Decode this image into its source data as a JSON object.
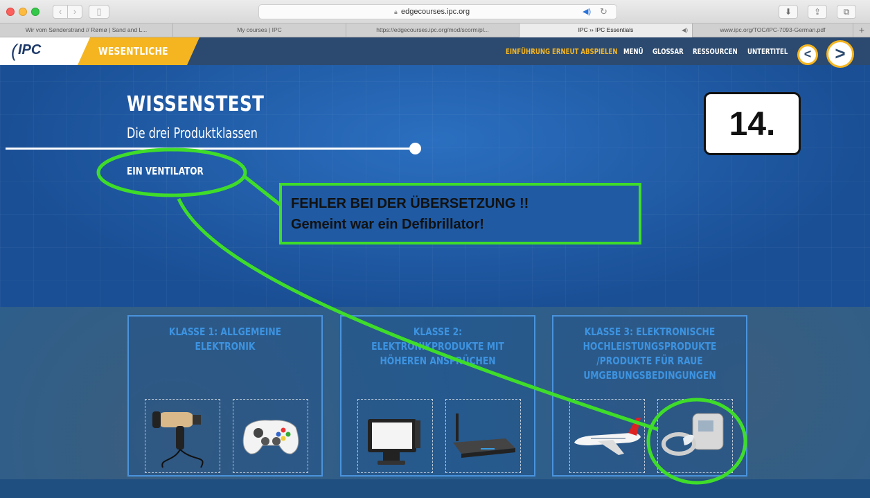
{
  "browser": {
    "url": "edgecourses.ipc.org",
    "tabs": [
      {
        "label": "Wir vom Sønderstrand // Rømø | Sand and L..."
      },
      {
        "label": "My courses | IPC"
      },
      {
        "label": "https://edgecourses.ipc.org/mod/scorm/pl..."
      },
      {
        "label": "IPC ›› IPC Essentials"
      },
      {
        "label": "www.ipc.org/TOC/IPC-7093-German.pdf"
      }
    ],
    "new_tab_label": "+"
  },
  "course": {
    "logo": "IPC",
    "module": "WESENTLICHE",
    "menu": {
      "replay": "EINFÜHRUNG ERNEUT ABSPIELEN",
      "menu": "MENÜ",
      "glossary": "GLOSSAR",
      "resources": "RESSOURCEN",
      "subtitles": "UNTERTITEL"
    },
    "nav": {
      "prev": "<",
      "next": ">"
    },
    "title": "WISSENSTEST",
    "subtitle": "Die drei Produktklassen",
    "answer": "EIN VENTILATOR",
    "cards": [
      {
        "title_lines": [
          "KLASSE 1: ALLGEMEINE",
          "ELEKTRONIK"
        ],
        "products": [
          "hair-dryer",
          "game-controller"
        ]
      },
      {
        "title_lines": [
          "KLASSE 2:",
          "ELEKTRONIKPRODUKTE MIT",
          "HÖHEREN ANSPRÜCHEN"
        ],
        "products": [
          "pos-terminal",
          "wifi-router"
        ]
      },
      {
        "title_lines": [
          "KLASSE 3: ELEKTRONISCHE",
          "HOCHLEISTUNGSPRODUKTE",
          "/PRODUKTE FÜR RAUE",
          "UMGEBUNGSBEDINGUNGEN"
        ],
        "products": [
          "airplane",
          "medical-device"
        ]
      }
    ]
  },
  "annotation": {
    "callout_line1": "FEHLER BEI DER ÜBERSETZUNG !!",
    "callout_line2": "Gemeint war ein Defibrillator!",
    "step": "14.",
    "color": "#3fdd2a"
  }
}
